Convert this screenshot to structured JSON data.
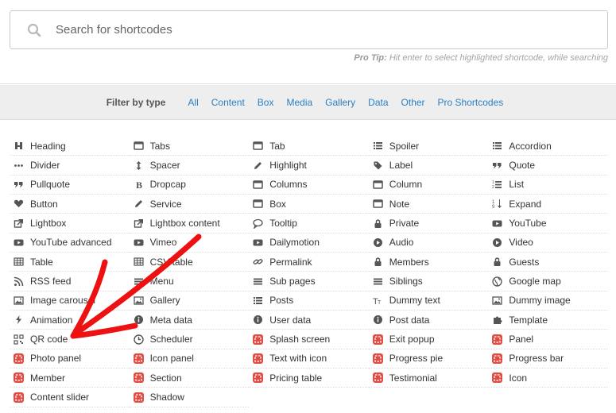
{
  "search": {
    "placeholder": "Search for shortcodes"
  },
  "protip": {
    "label": "Pro Tip:",
    "text": "Hit enter to select highlighted shortcode, while searching"
  },
  "filter": {
    "label": "Filter by type",
    "types": [
      "All",
      "Content",
      "Box",
      "Media",
      "Gallery",
      "Data",
      "Other",
      "Pro Shortcodes"
    ]
  },
  "colors": {
    "accent": "#2a7fc4",
    "pro_badge": "#e14d43",
    "annotation_arrow": "#ee1111"
  },
  "shortcodes": [
    {
      "label": "Heading",
      "icon": "heading"
    },
    {
      "label": "Tabs",
      "icon": "tabs"
    },
    {
      "label": "Tab",
      "icon": "tab"
    },
    {
      "label": "Spoiler",
      "icon": "list"
    },
    {
      "label": "Accordion",
      "icon": "list"
    },
    {
      "label": "Divider",
      "icon": "dots"
    },
    {
      "label": "Spacer",
      "icon": "arrows-v"
    },
    {
      "label": "Highlight",
      "icon": "pencil"
    },
    {
      "label": "Label",
      "icon": "tag"
    },
    {
      "label": "Quote",
      "icon": "quote"
    },
    {
      "label": "Pullquote",
      "icon": "quote"
    },
    {
      "label": "Dropcap",
      "icon": "bold"
    },
    {
      "label": "Columns",
      "icon": "tab"
    },
    {
      "label": "Column",
      "icon": "tab"
    },
    {
      "label": "List",
      "icon": "list-ol"
    },
    {
      "label": "Button",
      "icon": "heart"
    },
    {
      "label": "Service",
      "icon": "pencil"
    },
    {
      "label": "Box",
      "icon": "tab"
    },
    {
      "label": "Note",
      "icon": "tab"
    },
    {
      "label": "Expand",
      "icon": "sort"
    },
    {
      "label": "Lightbox",
      "icon": "external"
    },
    {
      "label": "Lightbox content",
      "icon": "external"
    },
    {
      "label": "Tooltip",
      "icon": "comment"
    },
    {
      "label": "Private",
      "icon": "lock"
    },
    {
      "label": "YouTube",
      "icon": "youtube"
    },
    {
      "label": "YouTube advanced",
      "icon": "youtube"
    },
    {
      "label": "Vimeo",
      "icon": "youtube"
    },
    {
      "label": "Dailymotion",
      "icon": "youtube"
    },
    {
      "label": "Audio",
      "icon": "play-circle"
    },
    {
      "label": "Video",
      "icon": "play-circle"
    },
    {
      "label": "Table",
      "icon": "table"
    },
    {
      "label": "CSV table",
      "icon": "table"
    },
    {
      "label": "Permalink",
      "icon": "link"
    },
    {
      "label": "Members",
      "icon": "lock"
    },
    {
      "label": "Guests",
      "icon": "lock"
    },
    {
      "label": "RSS feed",
      "icon": "rss"
    },
    {
      "label": "Menu",
      "icon": "bars"
    },
    {
      "label": "Sub pages",
      "icon": "bars"
    },
    {
      "label": "Siblings",
      "icon": "bars"
    },
    {
      "label": "Google map",
      "icon": "globe"
    },
    {
      "label": "Image carousel",
      "icon": "image"
    },
    {
      "label": "Gallery",
      "icon": "image"
    },
    {
      "label": "Posts",
      "icon": "list"
    },
    {
      "label": "Dummy text",
      "icon": "text-height"
    },
    {
      "label": "Dummy image",
      "icon": "image"
    },
    {
      "label": "Animation",
      "icon": "bolt"
    },
    {
      "label": "Meta data",
      "icon": "info"
    },
    {
      "label": "User data",
      "icon": "info"
    },
    {
      "label": "Post data",
      "icon": "info"
    },
    {
      "label": "Template",
      "icon": "puzzle"
    },
    {
      "label": "QR code",
      "icon": "qrcode"
    },
    {
      "label": "Scheduler",
      "icon": "clock"
    },
    {
      "label": "Splash screen",
      "icon": "pro"
    },
    {
      "label": "Exit popup",
      "icon": "pro"
    },
    {
      "label": "Panel",
      "icon": "pro"
    },
    {
      "label": "Photo panel",
      "icon": "pro"
    },
    {
      "label": "Icon panel",
      "icon": "pro"
    },
    {
      "label": "Text with icon",
      "icon": "pro"
    },
    {
      "label": "Progress pie",
      "icon": "pro"
    },
    {
      "label": "Progress bar",
      "icon": "pro"
    },
    {
      "label": "Member",
      "icon": "pro"
    },
    {
      "label": "Section",
      "icon": "pro"
    },
    {
      "label": "Pricing table",
      "icon": "pro"
    },
    {
      "label": "Testimonial",
      "icon": "pro"
    },
    {
      "label": "Icon",
      "icon": "pro"
    },
    {
      "label": "Content slider",
      "icon": "pro"
    },
    {
      "label": "Shadow",
      "icon": "pro"
    }
  ]
}
